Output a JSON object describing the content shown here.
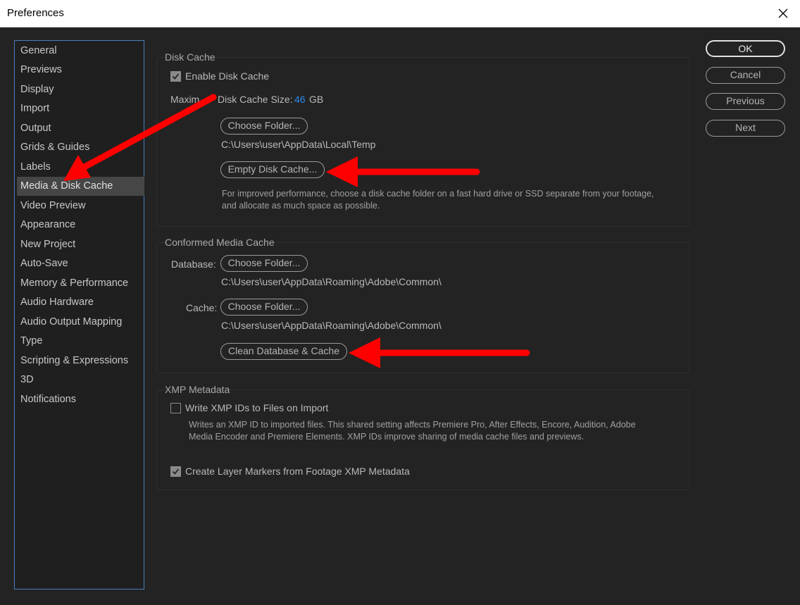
{
  "window": {
    "title": "Preferences"
  },
  "sidebar": {
    "items": [
      {
        "label": "General"
      },
      {
        "label": "Previews"
      },
      {
        "label": "Display"
      },
      {
        "label": "Import"
      },
      {
        "label": "Output"
      },
      {
        "label": "Grids & Guides"
      },
      {
        "label": "Labels"
      },
      {
        "label": "Media & Disk Cache"
      },
      {
        "label": "Video Preview"
      },
      {
        "label": "Appearance"
      },
      {
        "label": "New Project"
      },
      {
        "label": "Auto-Save"
      },
      {
        "label": "Memory & Performance"
      },
      {
        "label": "Audio Hardware"
      },
      {
        "label": "Audio Output Mapping"
      },
      {
        "label": "Type"
      },
      {
        "label": "Scripting & Expressions"
      },
      {
        "label": "3D"
      },
      {
        "label": "Notifications"
      }
    ],
    "selected_label": "Media & Disk Cache"
  },
  "buttons": {
    "ok": "OK",
    "cancel": "Cancel",
    "previous": "Previous",
    "next": "Next"
  },
  "disk_cache": {
    "title": "Disk Cache",
    "enable_label": "Enable Disk Cache",
    "enable_checked": true,
    "max_size_prefix": "Maxim",
    "max_size_suffix": "Disk Cache Size:",
    "max_size_value": "46",
    "max_size_unit": "GB",
    "choose_folder": "Choose Folder...",
    "folder_path": "C:\\Users\\user\\AppData\\Local\\Temp",
    "empty_button": "Empty Disk Cache...",
    "hint_line1": "For improved performance, choose a disk cache folder on a fast hard drive or SSD separate from your footage,",
    "hint_line2": "and allocate as much space as possible."
  },
  "conformed_cache": {
    "title": "Conformed Media Cache",
    "database_label": "Database:",
    "database_button": "Choose Folder...",
    "database_path": "C:\\Users\\user\\AppData\\Roaming\\Adobe\\Common\\",
    "cache_label": "Cache:",
    "cache_button": "Choose Folder...",
    "cache_path": "C:\\Users\\user\\AppData\\Roaming\\Adobe\\Common\\",
    "clean_button": "Clean Database & Cache"
  },
  "xmp": {
    "title": "XMP Metadata",
    "write_ids_label": "Write XMP IDs to Files on Import",
    "write_ids_checked": false,
    "write_ids_desc1": "Writes an XMP ID to imported files. This shared setting affects Premiere Pro, After Effects, Encore, Audition, Adobe",
    "write_ids_desc2": "Media Encoder and Premiere Elements. XMP IDs improve sharing of media cache files and previews.",
    "layer_markers_label": "Create Layer Markers from Footage XMP Metadata",
    "layer_markers_checked": true
  },
  "annotations": {
    "arrow_color": "#ff0000"
  },
  "colors": {
    "accent_blue": "#2d8ceb",
    "sidebar_border": "#4a7ebb",
    "background": "#232323"
  }
}
